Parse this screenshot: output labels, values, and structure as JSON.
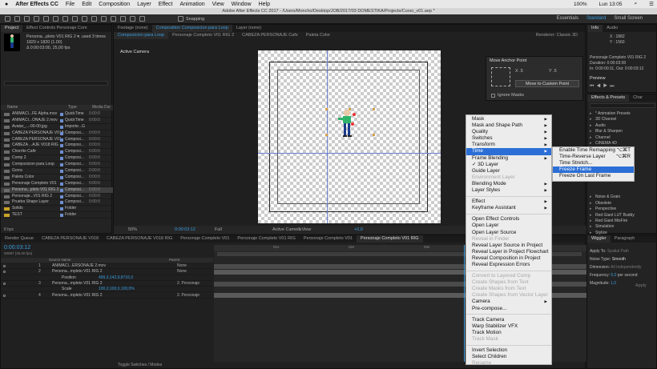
{
  "menubar": {
    "app": "After Effects CC",
    "items": [
      "File",
      "Edit",
      "Composition",
      "Layer",
      "Effect",
      "Animation",
      "View",
      "Window",
      "Help"
    ],
    "battery": "100%",
    "time": "Lun 13:05"
  },
  "title": "Adobe After Effects CC 2017 - /Users/Moncho/Desktop/JOB/2017/03 DOMESTIKA/Projects/Curso_v01.aep *",
  "toolbar": {
    "snapping": "Snapping",
    "workspaces": [
      "Essentials",
      "Standard",
      "Small Screen"
    ]
  },
  "project": {
    "tabs": [
      "Project",
      "Effect Controls Personaje Com"
    ],
    "info_name": "Persona...pleto V01 RIG 2 ▾, used 3 times",
    "info_size": "1820 x 1820 (1.00)",
    "info_dur": "Δ 0:00:03:00, 25,00 fps",
    "headers": [
      "Name",
      "Type",
      "Media Dur"
    ],
    "items": [
      {
        "name": "ANIMACI...FE Alpha.mov",
        "type": "QuickTime",
        "dur": "0:00:0",
        "kind": "file"
      },
      {
        "name": "ANIMACI...ONAJE 2.mov",
        "type": "QuickTime",
        "dur": "0:00:0",
        "kind": "file"
      },
      {
        "name": "Avatar_...-00-00.jpg",
        "type": "Importe...G",
        "dur": "",
        "kind": "file"
      },
      {
        "name": "CABEZA PERSONAJE V018",
        "type": "Composi...",
        "dur": "0:00:0",
        "kind": "comp"
      },
      {
        "name": "CABEZA PERSONAJE V01",
        "type": "Composi...",
        "dur": "0:00:0",
        "kind": "comp"
      },
      {
        "name": "CABEZA ...AJE V018 RIG",
        "type": "Composi...",
        "dur": "0:00:0",
        "kind": "comp"
      },
      {
        "name": "Chorrito Café",
        "type": "Composi...",
        "dur": "0:00:0",
        "kind": "comp"
      },
      {
        "name": "Comp 2",
        "type": "Composi...",
        "dur": "0:00:0",
        "kind": "comp"
      },
      {
        "name": "Composicion para Loop",
        "type": "Composi...",
        "dur": "0:00:0",
        "kind": "comp"
      },
      {
        "name": "Gorra",
        "type": "Composi...",
        "dur": "0:00:0",
        "kind": "comp"
      },
      {
        "name": "Paleta Color",
        "type": "Composi...",
        "dur": "0:00:0",
        "kind": "comp"
      },
      {
        "name": "Personaje Completo V01",
        "type": "Composi...",
        "dur": "0:00:0",
        "kind": "comp"
      },
      {
        "name": "Persona...pleto V01 RIG 2",
        "type": "Composi...",
        "dur": "0:00:0",
        "kind": "comp",
        "sel": true
      },
      {
        "name": "Personaje...V01 RIG 2",
        "type": "Composi...",
        "dur": "0:00:0",
        "kind": "comp"
      },
      {
        "name": "Prueba Shape Layer",
        "type": "Composi...",
        "dur": "0:00:0",
        "kind": "comp"
      },
      {
        "name": "Solids",
        "type": "Folder",
        "dur": "",
        "kind": "folder"
      },
      {
        "name": "TEST",
        "type": "Folder",
        "dur": "",
        "kind": "folder"
      }
    ],
    "footer": "8 bpc"
  },
  "comp": {
    "tabs": [
      "Footage (none)",
      "Composition Composicion para Loop",
      "Layer (none)"
    ],
    "subtabs": [
      "Composicion para Loop",
      "Personaje Completo V01 RIG 2",
      "CABEZA PERSONAJE Cafe",
      "Paleta Color"
    ],
    "renderer": "Renderer:  Classic 3D",
    "camera_label": "Active Camera",
    "zoom": "50%",
    "time": "0:00:03:12",
    "quality": "Full",
    "view": "Active Camera",
    "views": "1 View",
    "exposure": "+0,0"
  },
  "anchor": {
    "title": "Move Anchor Point",
    "x": "X .5",
    "y": "Y .5",
    "button": "Move to Custom Point",
    "ignore": "Ignore Masks"
  },
  "info": {
    "tabs": [
      "Info",
      "Audio"
    ],
    "coords": [
      "X : 1882",
      "Y : 1560"
    ],
    "name": "Personaje Completo V01 RIG 2",
    "duration": "Duration: 0:00:03:00",
    "inout": "In: 0:00:00:11, Out: 0:00:03:12",
    "preview": "Preview"
  },
  "effects": {
    "tabs": [
      "Effects & Presets",
      "Char"
    ],
    "items": [
      "* Animation Presets",
      "3D Channel",
      "Audio",
      "Blur & Sharpen",
      "Channel",
      "CINEMA 4D",
      "Noise & Grain",
      "Obsolete",
      "Perspective",
      "Red Giant LUT Buddy",
      "Red Giant MisFire",
      "Simulation",
      "Stylize"
    ]
  },
  "wiggler": {
    "tabs": [
      "Wiggler",
      "Paragraph"
    ],
    "apply_to": "Apply To:",
    "apply_to_val": "Spatial Path",
    "noise": "Noise Type:",
    "noise_val": "Smooth",
    "dims": "Dimension:",
    "dims_val": "All Independently",
    "freq": "Frequency:",
    "freq_val": "5,0",
    "freq_unit": "per second",
    "mag": "Magnitude:",
    "mag_val": "1,0",
    "apply": "Apply"
  },
  "timeline": {
    "tabs": [
      "Render Queue",
      "CABEZA PERSONAJE V018",
      "CABEZA PERSONAJE V018 RIG",
      "Personaje Completo V01",
      "Personaje Completo V01 RIG",
      "Personaje Completo V01",
      "Personaje Completo V01 RIG"
    ],
    "time": "0:00:03:12",
    "fps": "00087 (25.00 fps)",
    "col_source": "Source Name",
    "col_parent": "Parent",
    "rows": [
      {
        "num": "1",
        "name": "ANIMACI...ERSONAJE 2.mov",
        "parent": "None"
      },
      {
        "num": "2",
        "name": "Persona...mpleto V01 RIG 2",
        "parent": "None"
      },
      {
        "num": "",
        "name": "Position",
        "parent": "499,3,142,9,8716,0",
        "sub": true
      },
      {
        "num": "3",
        "name": "Persona...mpleto V01 RIG 2",
        "parent": "2. Personaje"
      },
      {
        "num": "",
        "name": "Scale",
        "parent": "100,0,100,0,100,0%",
        "sub": true
      },
      {
        "num": "4",
        "name": "Persona...mpleto V01 RIG 2",
        "parent": "2. Personaje"
      }
    ],
    "toggle": "Toggle Switches / Modes",
    "ruler": [
      "01s",
      "02s",
      "03s"
    ]
  },
  "menu": {
    "items": [
      {
        "label": "Mask",
        "arrow": true
      },
      {
        "label": "Mask and Shape Path",
        "arrow": true
      },
      {
        "label": "Quality",
        "arrow": true
      },
      {
        "label": "Switches",
        "arrow": true
      },
      {
        "label": "Transform",
        "arrow": true
      },
      {
        "label": "Time",
        "arrow": true,
        "hi": true
      },
      {
        "label": "Frame Blending",
        "arrow": true
      },
      {
        "label": "✓ 3D Layer"
      },
      {
        "label": "Guide Layer"
      },
      {
        "label": "Environment Layer",
        "dis": true
      },
      {
        "label": "Blending Mode",
        "arrow": true
      },
      {
        "label": "Layer Styles",
        "arrow": true
      },
      {
        "sep": true
      },
      {
        "label": "Effect",
        "arrow": true
      },
      {
        "label": "Keyframe Assistant",
        "arrow": true
      },
      {
        "sep": true
      },
      {
        "label": "Open Effect Controls"
      },
      {
        "label": "Open Layer"
      },
      {
        "label": "Open Layer Source"
      },
      {
        "label": "Reveal in Finder",
        "dis": true
      },
      {
        "label": "Reveal Layer Source in Project"
      },
      {
        "label": "Reveal Layer in Project Flowchart"
      },
      {
        "label": "Reveal Composition in Project"
      },
      {
        "label": "Reveal Expression Errors"
      },
      {
        "sep": true
      },
      {
        "label": "Convert to Layered Comp",
        "dis": true
      },
      {
        "label": "Create Shapes from Text",
        "dis": true
      },
      {
        "label": "Create Masks from Text",
        "dis": true
      },
      {
        "label": "Create Shapes from Vector Layer",
        "dis": true
      },
      {
        "label": "Camera",
        "arrow": true
      },
      {
        "label": "Pre-compose..."
      },
      {
        "sep": true
      },
      {
        "label": "Track Camera"
      },
      {
        "label": "Warp Stabilizer VFX"
      },
      {
        "label": "Track Motion"
      },
      {
        "label": "Track Mask",
        "dis": true
      },
      {
        "sep": true
      },
      {
        "label": "Invert Selection"
      },
      {
        "label": "Select Children"
      },
      {
        "label": "Rename",
        "dis": true
      }
    ]
  },
  "submenu": {
    "items": [
      {
        "label": "Enable Time Remapping",
        "kb": "⌥⌘T"
      },
      {
        "label": "Time-Reverse Layer",
        "kb": "⌥⌘R"
      },
      {
        "label": "Time Stretch..."
      },
      {
        "label": "Freeze Frame",
        "hi": true
      },
      {
        "label": "Freeze On Last Frame"
      }
    ]
  },
  "colors": {
    "accent": "#3a9de0",
    "highlight": "#2b6fd6",
    "folder": "#c9a227"
  }
}
